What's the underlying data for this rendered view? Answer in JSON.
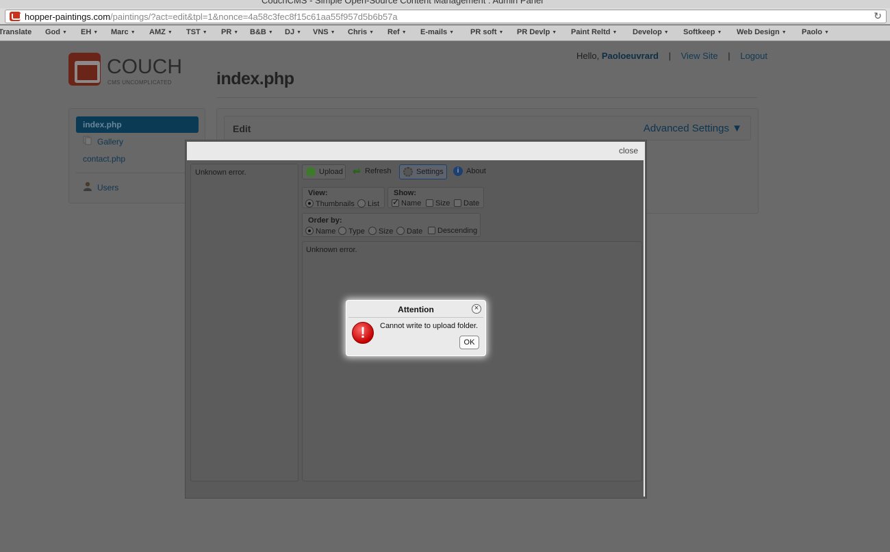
{
  "browser": {
    "window_title": "CouchCMS - Simple Open-Source Content Management : Admin Panel",
    "url_domain": "hopper-paintings.com",
    "url_path": "/paintings/?act=edit&tpl=1&nonce=4a58c3fec8f15c61aa55f957d5b6b57a",
    "reload_icon": "reload-icon"
  },
  "bookmarks": [
    "Translate",
    "God",
    "EH",
    "Marc",
    "AMZ",
    "TST",
    "PR",
    "B&B",
    "DJ",
    "VNS",
    "Chris",
    "Ref",
    "E-mails",
    "PR soft",
    "PR Devlp",
    "Paint Reltd",
    "Develop",
    "Softkeep",
    "Web Design",
    "Paolo"
  ],
  "header": {
    "logo_word": "COUCH",
    "logo_tagline": "CMS UNCOMPLICATED",
    "hello": "Hello,",
    "username": "Paoloeuvrard",
    "view_site": "View Site",
    "logout": "Logout",
    "separator": "|"
  },
  "page_title": "index.php",
  "sidebar": {
    "items": [
      {
        "label": "index.php",
        "active": true
      },
      {
        "label": "Gallery",
        "icon": "pages-icon"
      },
      {
        "label": "contact.php"
      },
      {
        "label": "Users",
        "icon": "user-icon"
      }
    ]
  },
  "main": {
    "edit_label": "Edit",
    "advanced_settings": "Advanced Settings ▼"
  },
  "file_manager": {
    "close": "close",
    "tree_message": "Unknown error.",
    "toolbar": {
      "upload": "Upload",
      "refresh": "Refresh",
      "settings": "Settings",
      "about": "About"
    },
    "view": {
      "legend": "View:",
      "thumbnails": "Thumbnails",
      "list": "List",
      "selected": "Thumbnails"
    },
    "show": {
      "legend": "Show:",
      "name": "Name",
      "size": "Size",
      "date": "Date",
      "checked": [
        "Name"
      ]
    },
    "order_by": {
      "legend": "Order by:",
      "name": "Name",
      "type": "Type",
      "size": "Size",
      "date": "Date",
      "descending": "Descending",
      "selected": "Name"
    },
    "list_message": "Unknown error."
  },
  "alert": {
    "title": "Attention",
    "message": "Cannot write to upload folder.",
    "ok": "OK",
    "close_glyph": "×",
    "icon_glyph": "!"
  },
  "colors": {
    "accent": "#0b3a55",
    "logo_red": "#6b2418",
    "error_red": "#c40000"
  }
}
